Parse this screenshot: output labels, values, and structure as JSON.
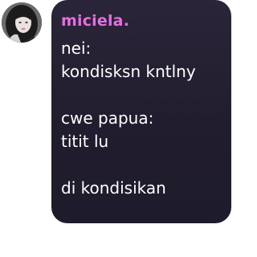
{
  "author": {
    "username": "miciela.",
    "username_color": "#e36fe0"
  },
  "bubble": {
    "background": "#221f30"
  },
  "message": {
    "lines": [
      "nei:",
      "kondisksn kntlny",
      "",
      "cwe papua:",
      "titit lu",
      "",
      "di kondisikan"
    ]
  }
}
